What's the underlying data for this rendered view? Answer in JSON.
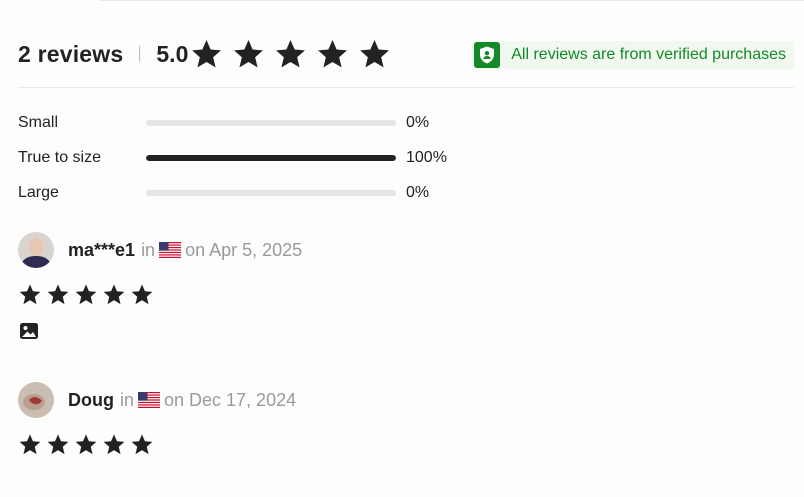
{
  "summary": {
    "reviews_count": "2 reviews",
    "rating": "5.0",
    "stars": 5,
    "verified_text": "All reviews are from verified purchases"
  },
  "fit": [
    {
      "label": "Small",
      "percent_text": "0%",
      "value": 0
    },
    {
      "label": "True to size",
      "percent_text": "100%",
      "value": 100
    },
    {
      "label": "Large",
      "percent_text": "0%",
      "value": 0
    }
  ],
  "reviews": [
    {
      "name": "ma***e1",
      "in_text": "in",
      "date_text": "on Apr 5, 2025",
      "stars": 5,
      "has_photo_icon": true
    },
    {
      "name": "Doug",
      "in_text": "in",
      "date_text": "on Dec 17, 2024",
      "stars": 5,
      "has_photo_icon": false
    }
  ],
  "icons": {
    "star": "star-icon",
    "shield": "verified-shield-icon",
    "flag": "us-flag-icon",
    "photo": "image-icon"
  },
  "colors": {
    "verified_green": "#138a27",
    "verified_bg": "#f0f8ef",
    "text_dark": "#222222",
    "text_muted": "#9a9a9a",
    "bar_track": "#e5e6e8",
    "bar_fill": "#222222"
  }
}
